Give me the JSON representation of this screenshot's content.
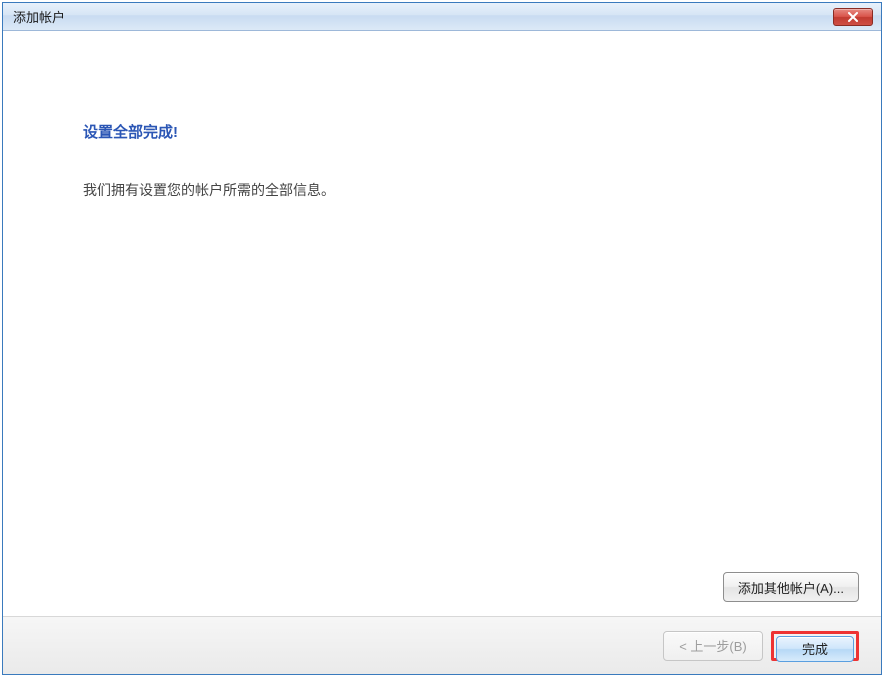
{
  "window": {
    "title": "添加帐户"
  },
  "content": {
    "heading": "设置全部完成!",
    "body": "我们拥有设置您的帐户所需的全部信息。"
  },
  "buttons": {
    "add_other": "添加其他帐户(A)...",
    "back": "< 上一步(B)",
    "finish": "完成"
  }
}
